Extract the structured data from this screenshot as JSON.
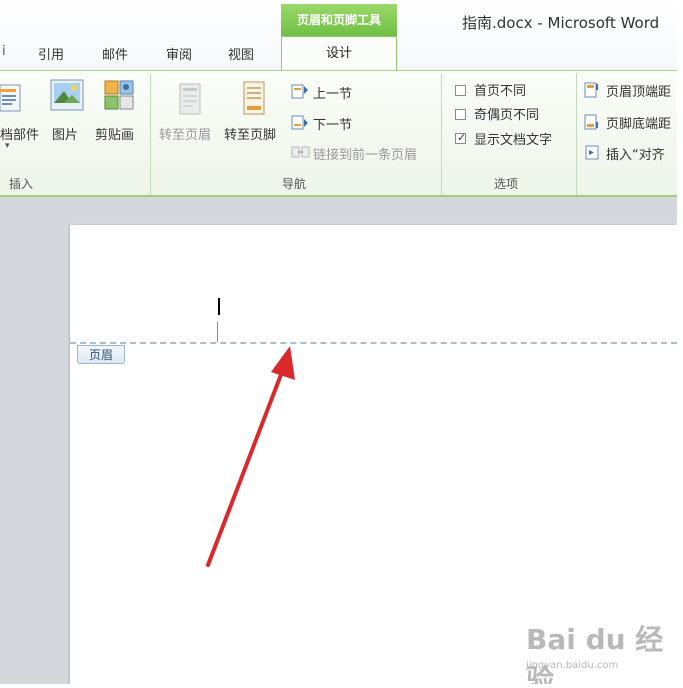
{
  "window": {
    "title": "指南.docx - Microsoft Word",
    "context_group": "页眉和页脚工具"
  },
  "tabs": [
    "引用",
    "邮件",
    "审阅",
    "视图"
  ],
  "active_tab": "设计",
  "ribbon": {
    "insert": {
      "label": "插入",
      "parts_label": "档部件",
      "picture_label": "图片",
      "clipart_label": "剪贴画"
    },
    "navigation": {
      "label": "导航",
      "goto_header": "转至页眉",
      "goto_footer": "转至页脚",
      "prev_section": "上一节",
      "next_section": "下一节",
      "link_previous": "链接到前一条页眉"
    },
    "options": {
      "label": "选项",
      "first_page": "首页不同",
      "odd_even": "奇偶页不同",
      "show_text": "显示文档文字",
      "first_page_checked": false,
      "odd_even_checked": false,
      "show_text_checked": true
    },
    "position": {
      "header_top": "页眉顶端距",
      "footer_bottom": "页脚底端距",
      "insert_align": "插入“对齐"
    }
  },
  "document": {
    "header_tag": "页眉"
  },
  "watermark": {
    "logo": "Bai du 经验",
    "url": "jingyan.baidu.com"
  },
  "colors": {
    "context_green": "#6fc044",
    "annotation_arrow": "#d9292b",
    "header_dash": "#a9bed0"
  }
}
